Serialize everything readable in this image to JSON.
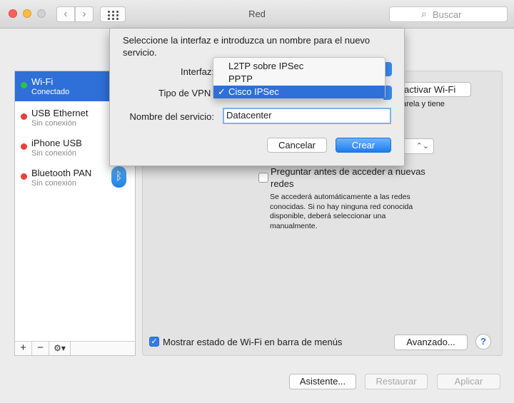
{
  "window": {
    "title": "Red"
  },
  "toolbar": {
    "back": "‹",
    "forward": "›",
    "search_placeholder": "Buscar"
  },
  "sidebar": {
    "items": [
      {
        "label": "Wi-Fi",
        "status": "Conectado",
        "color": "#2ec33f",
        "selected": true
      },
      {
        "label": "USB Ethernet",
        "status": "Sin conexión",
        "color": "#e8413b",
        "selected": false
      },
      {
        "label": "iPhone USB",
        "status": "Sin conexión",
        "color": "#e8413b",
        "selected": false
      },
      {
        "label": "Bluetooth PAN",
        "status": "Sin conexión",
        "color": "#e8413b",
        "selected": false
      }
    ],
    "tools": {
      "add": "+",
      "remove": "−",
      "gear": "⚙▾"
    },
    "bluetooth_icon": "ᛒ"
  },
  "main": {
    "wifi_button": "activar Wi-Fi",
    "wifi_desc": "arela y tiene",
    "ask_label": "Preguntar antes de acceder a nuevas redes",
    "ask_desc": "Se accederá automáticamente a las redes conocidas. Si no hay ninguna red conocida disponible, deberá seleccionar una manualmente.",
    "show_status_label": "Mostrar estado de Wi-Fi en barra de menús",
    "show_status_checked": true,
    "advanced_button": "Avanzado...",
    "help": "?"
  },
  "bottom": {
    "assist": "Asistente...",
    "restore": "Restaurar",
    "apply": "Aplicar"
  },
  "sheet": {
    "message": "Seleccione la interfaz e introduzca un nombre para el nuevo servicio.",
    "interface_label": "Interfaz:",
    "vpn_type_label": "Tipo de VPN",
    "service_name_label": "Nombre del servicio:",
    "service_name_value": "Datacenter",
    "cancel": "Cancelar",
    "create": "Crear"
  },
  "vpn_menu": {
    "options": [
      "L2TP sobre IPSec",
      "PPTP",
      "Cisco IPSec"
    ],
    "selected": "Cisco IPSec",
    "check": "✓"
  }
}
